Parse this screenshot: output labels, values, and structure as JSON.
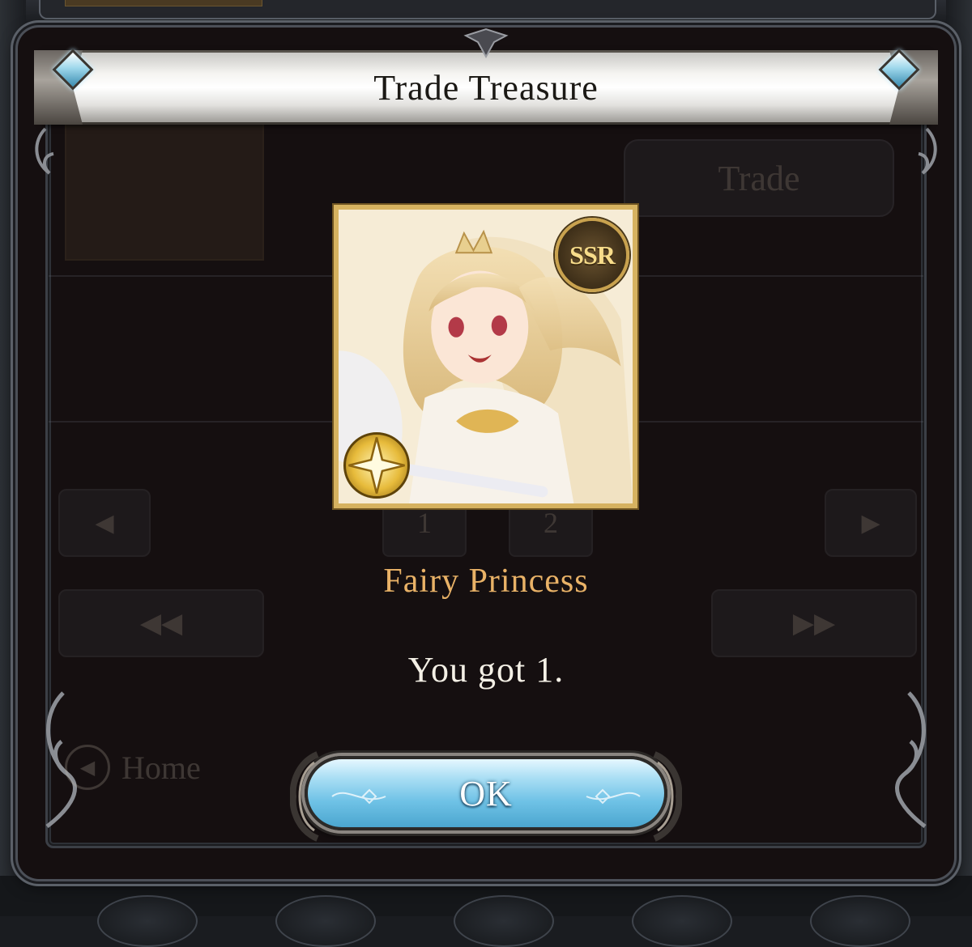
{
  "dialog": {
    "title": "Trade Treasure",
    "item_name": "Fairy Princess",
    "result_text": "You got 1.",
    "ok_label": "OK",
    "rarity_badge": "SSR",
    "element_icon": "light-element-icon"
  },
  "background": {
    "trade_button_label": "Trade",
    "page_numbers": [
      "1",
      "2"
    ],
    "prev_icon": "◀",
    "next_icon": "▶",
    "first_icon": "◀◀",
    "last_icon": "▶▶",
    "home_label": "Home",
    "home_icon": "◀"
  },
  "colors": {
    "item_name": "#e9b267",
    "result_text": "#f4f0e6",
    "ok_button": "#6fc2e6",
    "banner": "#f5f4f1",
    "card_frame": "#d6b260"
  }
}
